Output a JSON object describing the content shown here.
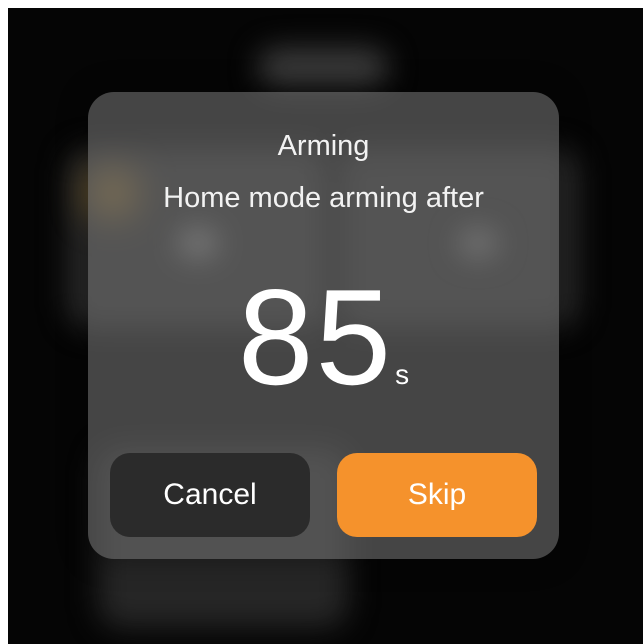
{
  "dialog": {
    "title": "Arming",
    "subtitle": "Home mode arming after",
    "countdown_value": "85",
    "countdown_unit": "s",
    "cancel_label": "Cancel",
    "skip_label": "Skip"
  },
  "colors": {
    "accent": "#F5922C",
    "cancel_button": "#2B2B2B",
    "background": "#050505"
  }
}
